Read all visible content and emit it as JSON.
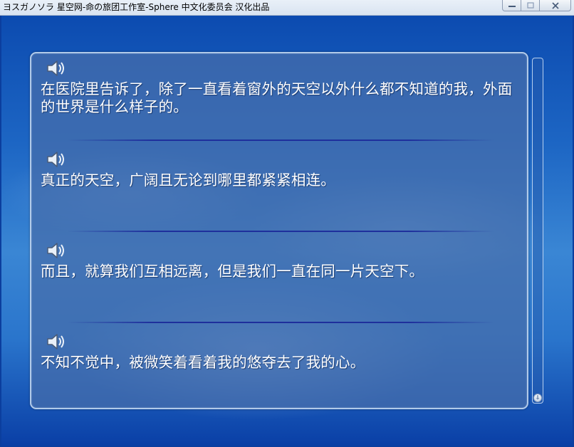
{
  "window": {
    "title": "ヨスガノソラ 星空网-命の旅团工作室-Sphere 中文化委员会 汉化出品",
    "min_label": "—",
    "max_label": "□",
    "close_label": "✕"
  },
  "backlog": {
    "entries": [
      {
        "text": "在医院里告诉了，除了一直看着窗外的天空以外什么都不知道的我，外面的世界是什么样子的。",
        "icon": "speaker-icon"
      },
      {
        "text": "真正的天空，广阔且无论到哪里都紧紧相连。",
        "icon": "speaker-icon"
      },
      {
        "text": "而且，就算我们互相远离，但是我们一直在同一片天空下。",
        "icon": "speaker-icon"
      },
      {
        "text": "不知不觉中，被微笑着看着我的悠夺去了我的心。",
        "icon": "speaker-icon"
      }
    ]
  },
  "scrollbar": {
    "down_arrow": "⇓"
  },
  "colors": {
    "panel": "#466eaa",
    "panel_border": "#c8dcf5",
    "separator": "#1e2f9c",
    "text": "#ffffff"
  }
}
